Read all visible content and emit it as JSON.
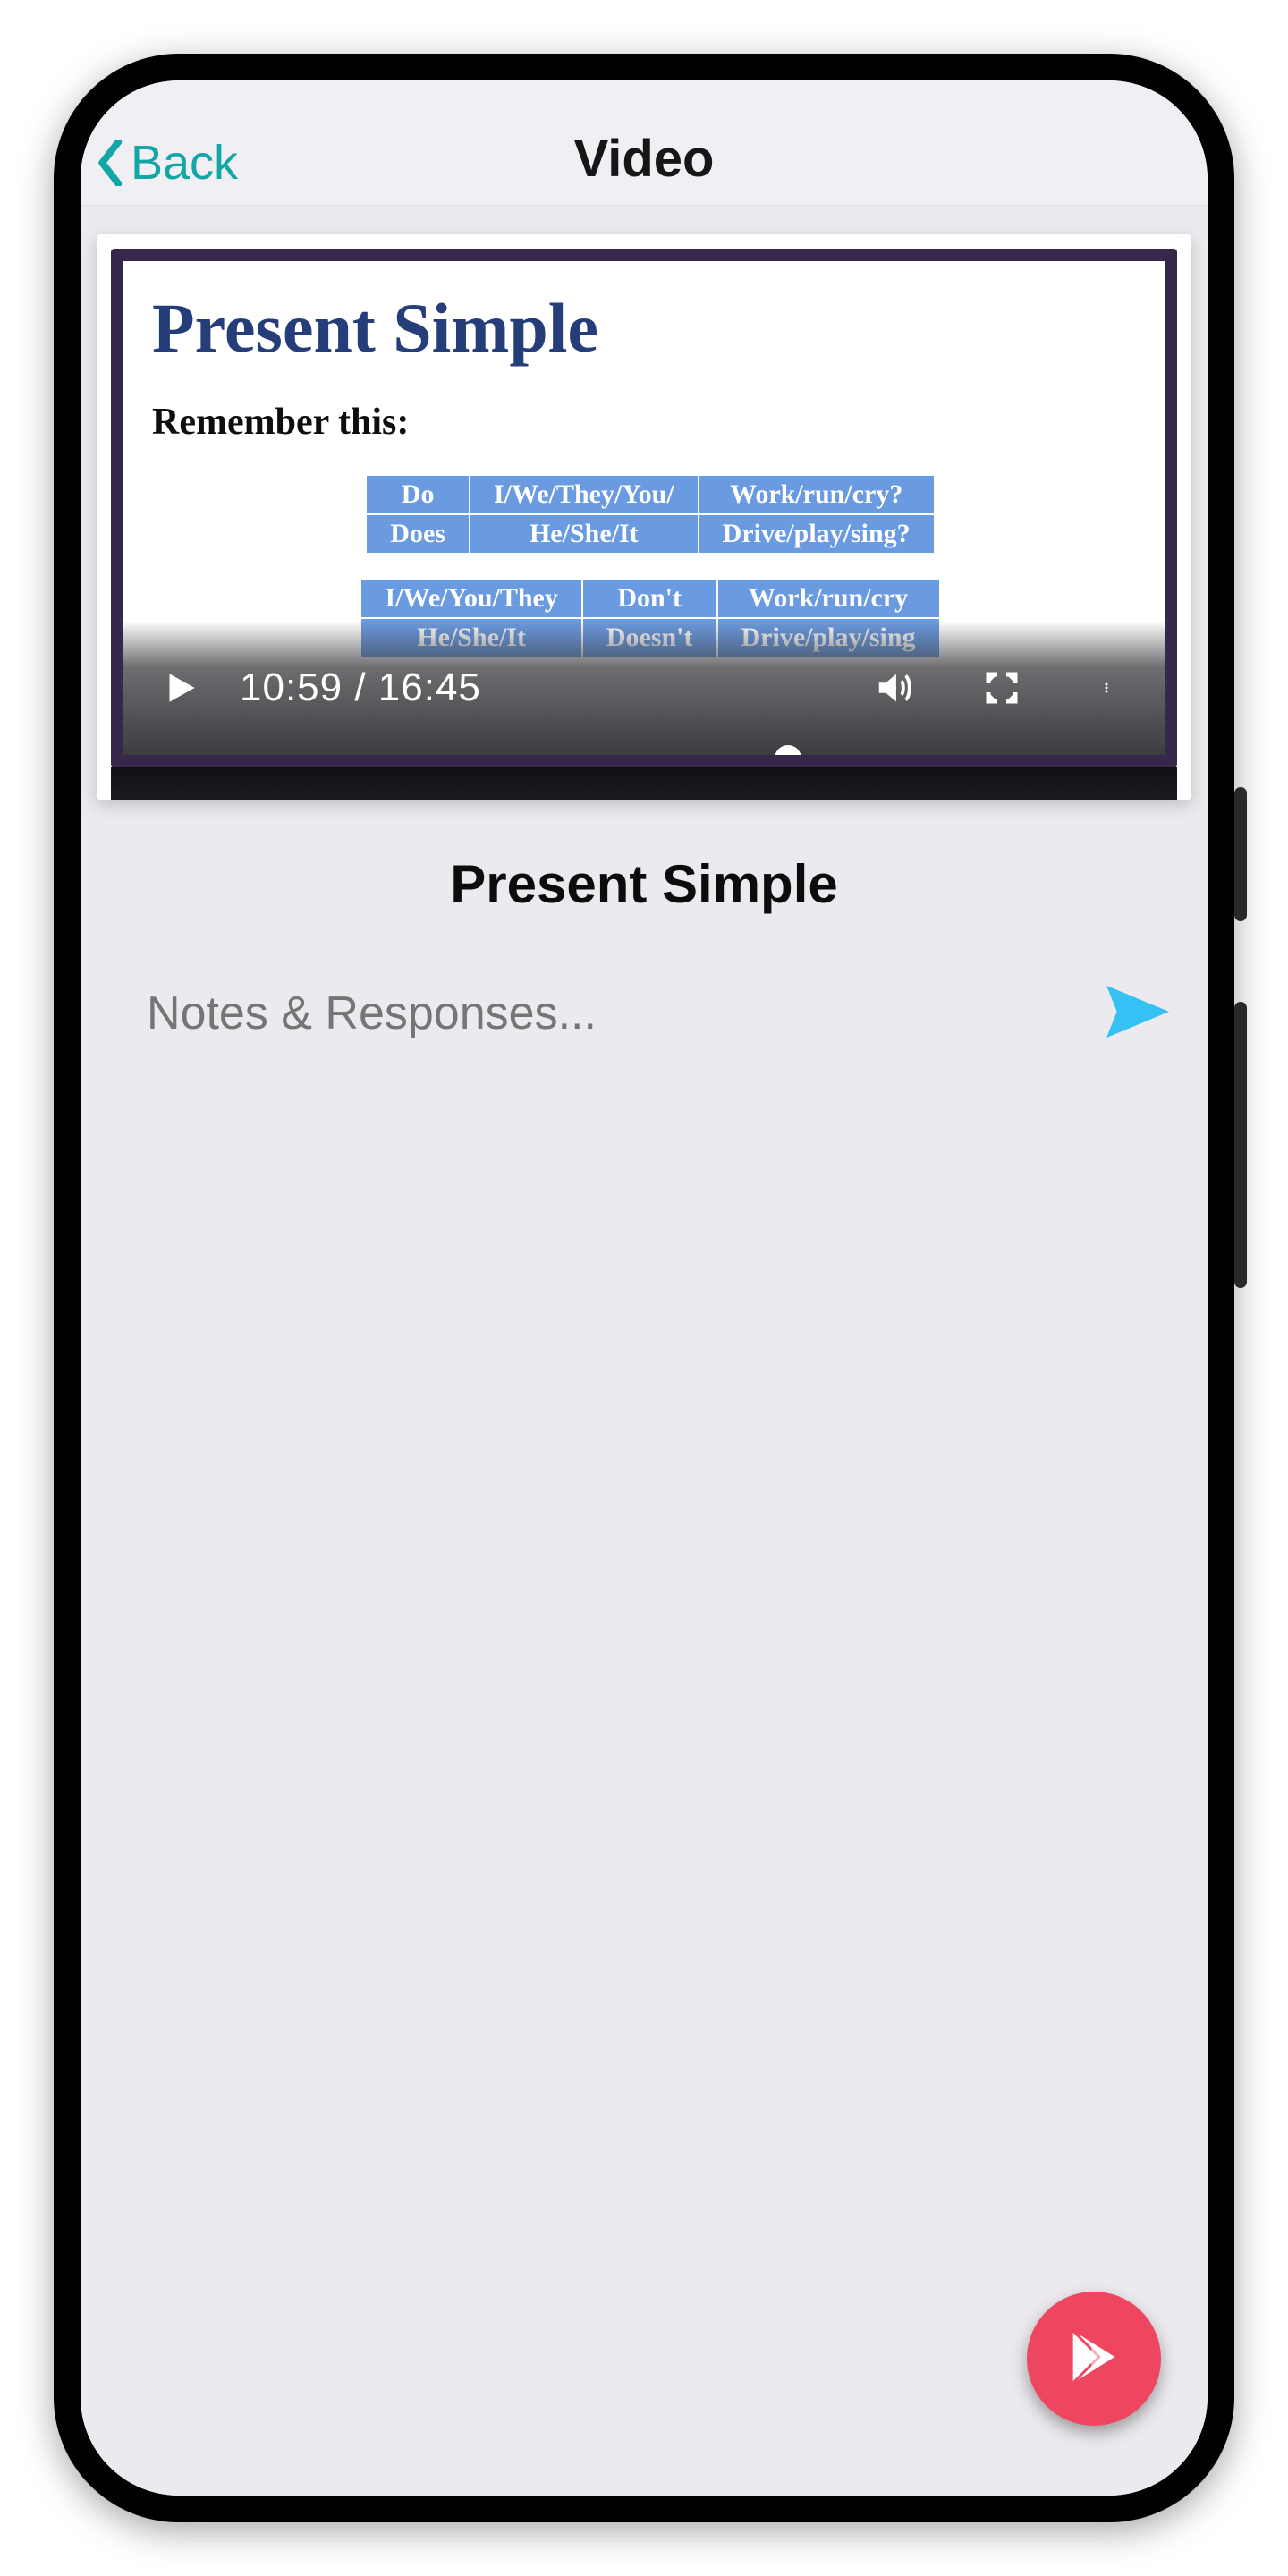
{
  "colors": {
    "accent_teal": "#13a6a6",
    "send_blue": "#35c1f4",
    "fab_red": "#ee4560",
    "slide_heading": "#253e79",
    "table_cell": "#6a9adf"
  },
  "topbar": {
    "back_label": "Back",
    "title": "Video"
  },
  "video": {
    "time_display": "10:59 / 16:45",
    "current_seconds": 659,
    "duration_seconds": 1005,
    "progress_percent": 65,
    "icons": {
      "play": "play-icon",
      "volume": "volume-icon",
      "fullscreen": "fullscreen-icon",
      "more": "more-icon"
    },
    "slide": {
      "heading": "Present Simple",
      "subheading": "Remember this:",
      "table1": [
        [
          "Do",
          "I/We/They/You/",
          "Work/run/cry?"
        ],
        [
          "Does",
          "He/She/It",
          "Drive/play/sing?"
        ]
      ],
      "table2": [
        [
          "I/We/You/They",
          "Don't",
          "Work/run/cry"
        ],
        [
          "He/She/It",
          "Doesn't",
          "Drive/play/sing"
        ]
      ]
    }
  },
  "lesson": {
    "title": "Present Simple"
  },
  "notes": {
    "placeholder": "Notes & Responses..."
  }
}
